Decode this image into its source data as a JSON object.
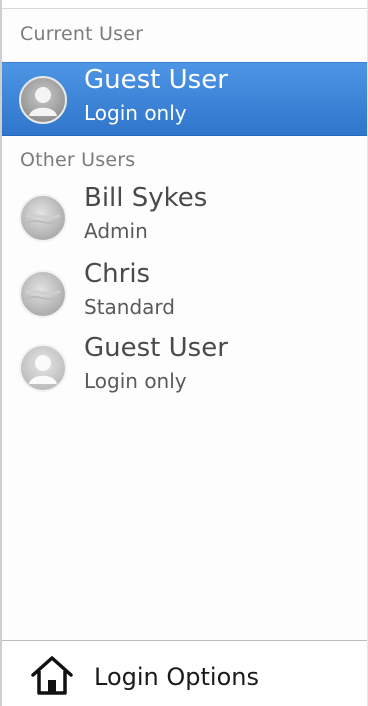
{
  "current_user": {
    "header": "Current User",
    "user": {
      "name": "Guest User",
      "role": "Login only",
      "avatar_icon": "person-silhouette-icon"
    }
  },
  "other_users": {
    "header": "Other Users",
    "users": [
      {
        "name": "Bill Sykes",
        "role": "Admin",
        "avatar_icon": "user-picture-icon"
      },
      {
        "name": "Chris",
        "role": "Standard",
        "avatar_icon": "user-picture-icon"
      },
      {
        "name": "Guest User",
        "role": "Login only",
        "avatar_icon": "person-silhouette-icon"
      }
    ]
  },
  "footer": {
    "login_options_label": "Login Options",
    "icon": "house-icon"
  },
  "colors": {
    "selection": "#3a82d6",
    "header_text": "#7c7c7c",
    "name_text": "#4a4a4a"
  }
}
